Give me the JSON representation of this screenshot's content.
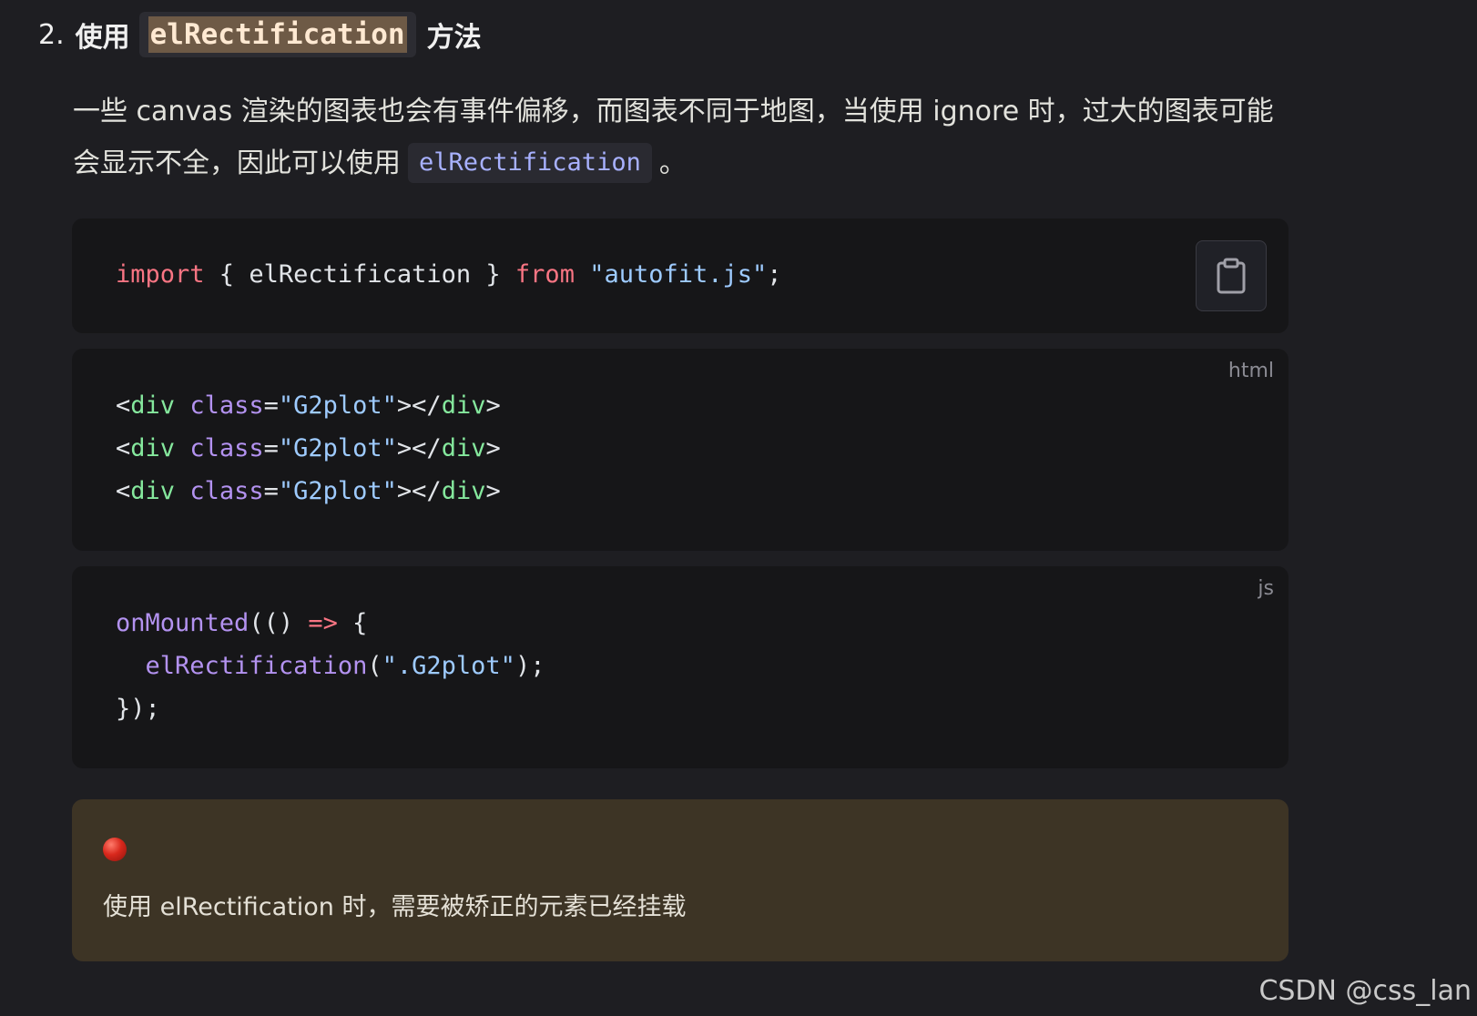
{
  "heading": {
    "number": "2.",
    "prefix": "使用",
    "code": "elRectification",
    "suffix": "方法"
  },
  "paragraph": {
    "text_before": "一些 canvas 渲染的图表也会有事件偏移，而图表不同于地图，当使用 ignore 时，过大的图表可能会显示不全，因此可以使用",
    "inline_code": "elRectification",
    "text_after": "。"
  },
  "code_blocks": [
    {
      "lang": "",
      "copy_button": "clipboard-icon",
      "lines": [
        [
          {
            "t": "import",
            "c": "kw"
          },
          {
            "t": " { elRectification } ",
            "c": "pl"
          },
          {
            "t": "from",
            "c": "kw"
          },
          {
            "t": " ",
            "c": "pl"
          },
          {
            "t": "\"autofit.js\"",
            "c": "str"
          },
          {
            "t": ";",
            "c": "pl"
          }
        ]
      ]
    },
    {
      "lang": "html",
      "lines": [
        [
          {
            "t": "<",
            "c": "pl"
          },
          {
            "t": "div",
            "c": "tag"
          },
          {
            "t": " ",
            "c": "pl"
          },
          {
            "t": "class",
            "c": "attr"
          },
          {
            "t": "=",
            "c": "pl"
          },
          {
            "t": "\"G2plot\"",
            "c": "str"
          },
          {
            "t": "></",
            "c": "pl"
          },
          {
            "t": "div",
            "c": "tag"
          },
          {
            "t": ">",
            "c": "pl"
          }
        ],
        [
          {
            "t": "<",
            "c": "pl"
          },
          {
            "t": "div",
            "c": "tag"
          },
          {
            "t": " ",
            "c": "pl"
          },
          {
            "t": "class",
            "c": "attr"
          },
          {
            "t": "=",
            "c": "pl"
          },
          {
            "t": "\"G2plot\"",
            "c": "str"
          },
          {
            "t": "></",
            "c": "pl"
          },
          {
            "t": "div",
            "c": "tag"
          },
          {
            "t": ">",
            "c": "pl"
          }
        ],
        [
          {
            "t": "<",
            "c": "pl"
          },
          {
            "t": "div",
            "c": "tag"
          },
          {
            "t": " ",
            "c": "pl"
          },
          {
            "t": "class",
            "c": "attr"
          },
          {
            "t": "=",
            "c": "pl"
          },
          {
            "t": "\"G2plot\"",
            "c": "str"
          },
          {
            "t": "></",
            "c": "pl"
          },
          {
            "t": "div",
            "c": "tag"
          },
          {
            "t": ">",
            "c": "pl"
          }
        ]
      ]
    },
    {
      "lang": "js",
      "lines": [
        [
          {
            "t": "onMounted",
            "c": "fn"
          },
          {
            "t": "(() ",
            "c": "pl"
          },
          {
            "t": "=>",
            "c": "kw"
          },
          {
            "t": " {",
            "c": "pl"
          }
        ],
        [
          {
            "t": "  ",
            "c": "pl"
          },
          {
            "t": "elRectification",
            "c": "fn"
          },
          {
            "t": "(",
            "c": "pl"
          },
          {
            "t": "\".G2plot\"",
            "c": "str"
          },
          {
            "t": ");",
            "c": "pl"
          }
        ],
        [
          {
            "t": "});",
            "c": "pl"
          }
        ]
      ]
    }
  ],
  "callout": {
    "icon": "red-circle-icon",
    "text": "使用 elRectification 时，需要被矫正的元素已经挂载"
  },
  "watermark": "CSDN @css_lan",
  "colors": {
    "background": "#1e1e22",
    "code_background": "#161618",
    "callout_background": "#3d3425",
    "keyword": "#f97583",
    "string": "#9ecbff",
    "tag": "#85e89d",
    "attribute": "#b392f0"
  }
}
